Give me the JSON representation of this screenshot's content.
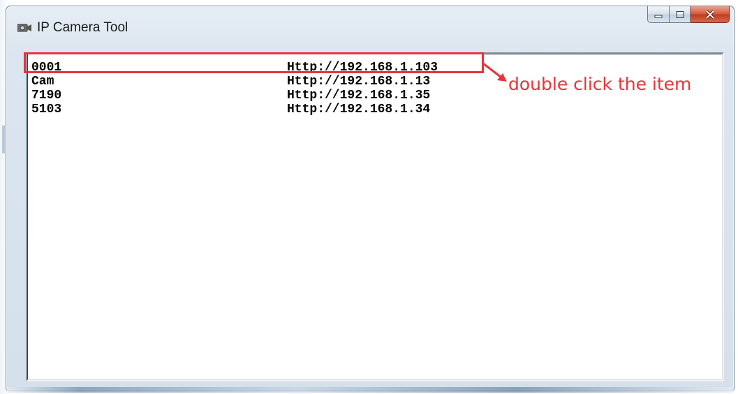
{
  "window": {
    "title": "IP Camera Tool",
    "app_icon": "camera-icon",
    "buttons": [
      "minimize-icon",
      "maximize-icon",
      "close-icon"
    ]
  },
  "camera_list": [
    {
      "name": "0001",
      "url": "Http://192.168.1.103"
    },
    {
      "name": "Cam",
      "url": "Http://192.168.1.13"
    },
    {
      "name": "7190",
      "url": "Http://192.168.1.35"
    },
    {
      "name": "5103",
      "url": "Http://192.168.1.34"
    }
  ],
  "annotation": {
    "text": "double click the item",
    "color": "#e8343a"
  }
}
